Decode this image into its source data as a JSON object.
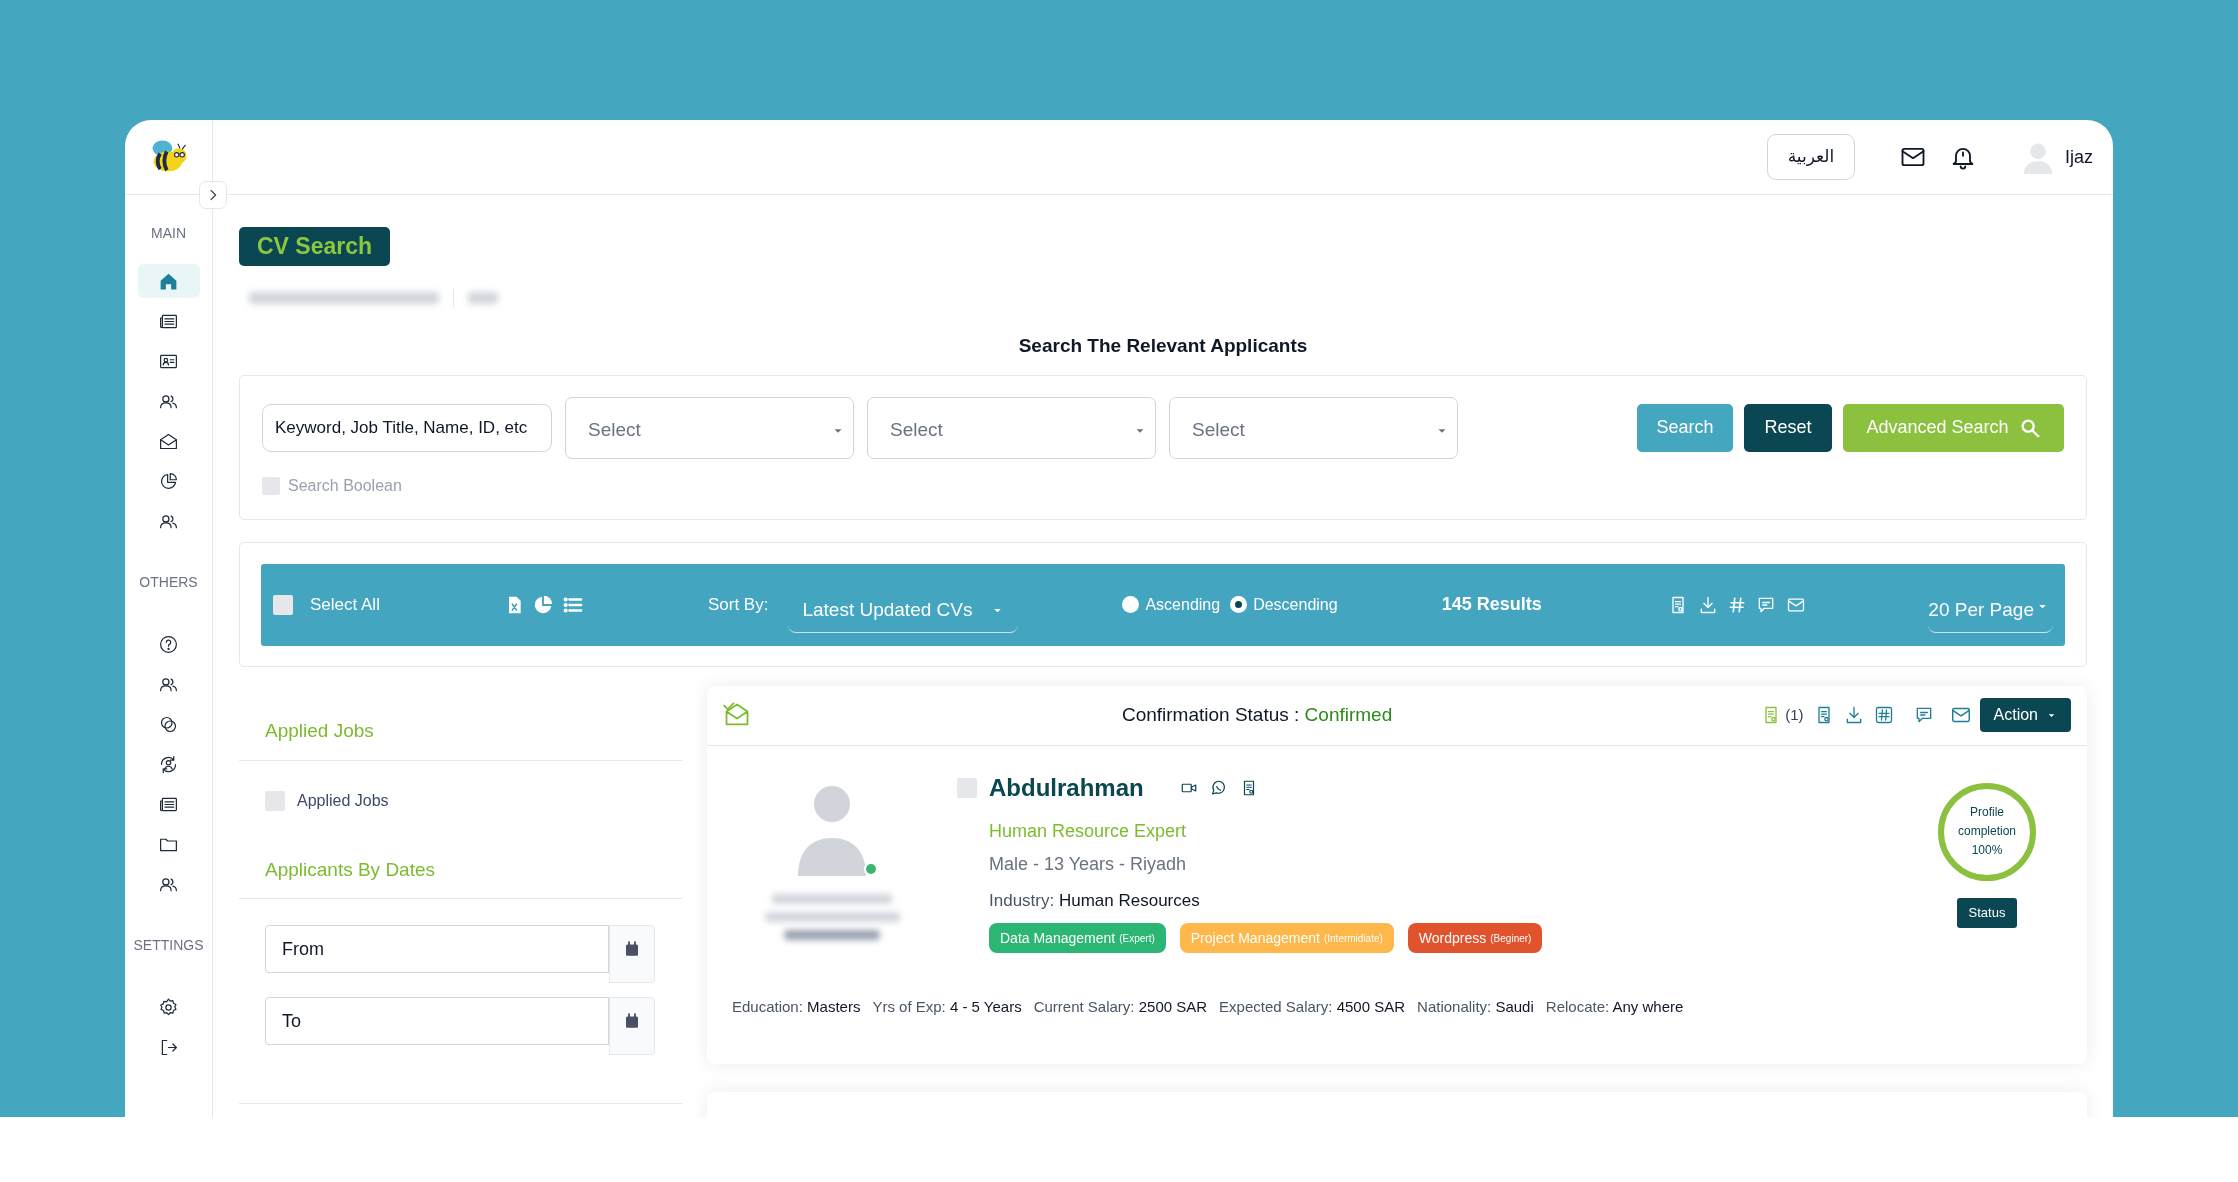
{
  "header": {
    "language_button": "العربية",
    "user_name": "Ijaz"
  },
  "sidebar": {
    "sections": [
      {
        "label": "MAIN",
        "items": [
          {
            "kind": "home",
            "selected": true
          },
          {
            "kind": "newspaper",
            "selected": false
          },
          {
            "kind": "id-card",
            "selected": false
          },
          {
            "kind": "users",
            "selected": false
          },
          {
            "kind": "mail-open",
            "selected": false
          },
          {
            "kind": "pie",
            "selected": false
          },
          {
            "kind": "users",
            "selected": false
          }
        ]
      },
      {
        "label": "OTHERS",
        "items": [
          {
            "kind": "help",
            "selected": false
          },
          {
            "kind": "users",
            "selected": false
          },
          {
            "kind": "circles",
            "selected": false
          },
          {
            "kind": "user-cycle",
            "selected": false
          },
          {
            "kind": "newspaper",
            "selected": false
          },
          {
            "kind": "folder",
            "selected": false
          },
          {
            "kind": "users",
            "selected": false
          }
        ]
      },
      {
        "label": "SETTINGS",
        "items": [
          {
            "kind": "gear",
            "selected": false
          },
          {
            "kind": "logout",
            "selected": false
          }
        ]
      }
    ]
  },
  "page_title": "CV Search",
  "search": {
    "heading": "Search The Relevant Applicants",
    "keyword_placeholder": "Keyword, Job Title, Name, ID, etc",
    "selects": [
      {
        "placeholder": "Select"
      },
      {
        "placeholder": "Select"
      },
      {
        "placeholder": "Select"
      }
    ],
    "boolean": {
      "label": "Search Boolean",
      "checked": false
    },
    "buttons": [
      {
        "label": "Search",
        "kind": "primary"
      },
      {
        "label": "Reset",
        "kind": "dark"
      },
      {
        "label": "Advanced Search",
        "kind": "accent"
      }
    ]
  },
  "toolbar": {
    "select_all": {
      "label": "Select All",
      "checked": false
    },
    "sort_label": "Sort By:",
    "sort_value": "Latest Updated CVs",
    "order": [
      {
        "label": "Ascending",
        "selected": false
      },
      {
        "label": "Descending",
        "selected": true
      }
    ],
    "results": "145 Results",
    "per_page": "20 Per Page"
  },
  "filters": [
    {
      "title": "Applied Jobs",
      "kind": "checkbox",
      "option": {
        "label": "Applied Jobs",
        "checked": false
      }
    },
    {
      "title": "Applicants By Dates",
      "kind": "dates",
      "fields": [
        {
          "placeholder": "From"
        },
        {
          "placeholder": "To"
        }
      ]
    }
  ],
  "candidate": {
    "confirmation_label": "Confirmation Status :",
    "confirmation_value": "Confirmed",
    "count": "(1)",
    "action": "Action",
    "online": true,
    "checked": false,
    "name": "Abdulrahman",
    "title": "Human Resource Expert",
    "summary": "Male - 13 Years - Riyadh",
    "industry_label": "Industry:",
    "industry_value": "Human Resources",
    "skills": [
      {
        "name": "Data Management",
        "grade": "(Expert)",
        "color": "#2bb673"
      },
      {
        "name": "Project Management",
        "grade": "(Intermidiate)",
        "color": "#fdb74a"
      },
      {
        "name": "Wordpress",
        "grade": "(Beginer)",
        "color": "#e0532c"
      }
    ],
    "profile": {
      "text": "Profile completion 100%",
      "level": 1
    },
    "status_button": "Status",
    "details": [
      {
        "label": "Education:",
        "value": "Masters"
      },
      {
        "label": "Yrs of Exp:",
        "value": "4 - 5 Years"
      },
      {
        "label": "Current Salary:",
        "value": "2500 SAR"
      },
      {
        "label": "Expected Salary:",
        "value": "4500 SAR"
      },
      {
        "label": "Nationality:",
        "value": "Saudi"
      },
      {
        "label": "Relocate:",
        "value": "Any where"
      }
    ]
  }
}
